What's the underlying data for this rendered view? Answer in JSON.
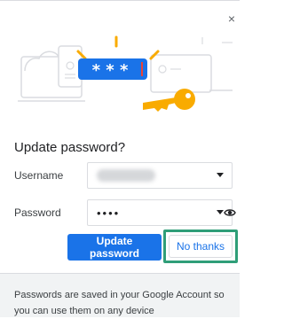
{
  "dialog": {
    "title": "Update password?",
    "close_icon": "close-icon",
    "close_glyph": "×",
    "username_label": "Username",
    "password_label": "Password",
    "password_value": "••••",
    "update_button": "Update password",
    "no_thanks_button": "No thanks",
    "footer_text": "Passwords are saved in your Google Account so you can use them on any device"
  },
  "illustration": {
    "masked_text": "* * *",
    "icons": [
      "laptop-icon",
      "phone-icon",
      "key-icon",
      "password-field-icon",
      "cloud-icon"
    ]
  },
  "colors": {
    "accent": "#1a73e8",
    "highlight": "#2f9e78",
    "key": "#f9ab00"
  }
}
